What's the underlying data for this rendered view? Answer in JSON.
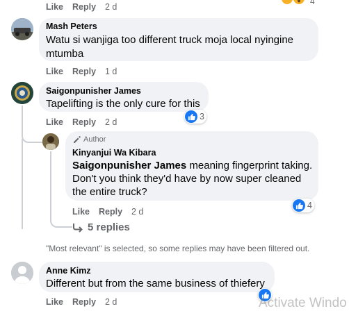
{
  "comment0": {
    "like": "Like",
    "reply": "Reply",
    "time": "2 d",
    "reaction_count": "4"
  },
  "comment1": {
    "author": "Mash Peters",
    "text_line1": "Watu si wanjiga too different truck moja local nyingine",
    "text_line2": "mtumba",
    "like": "Like",
    "reply": "Reply",
    "time": "1 d"
  },
  "comment2": {
    "author": "Saigonpunisher James",
    "text": "Tapelifting is the only cure for this",
    "like": "Like",
    "reply": "Reply",
    "time": "2 d",
    "reaction_count": "3"
  },
  "reply1": {
    "badge": "Author",
    "author": "Kinyanjui Wa Kibara",
    "mention": "Saigonpunisher James",
    "text_line1": " meaning fingerprint taking.",
    "text_line2": "Don't you think they'd have by now super cleaned",
    "text_line3": "the entire truck?",
    "like": "Like",
    "reply": "Reply",
    "time": "2 d",
    "reaction_count": "4"
  },
  "replies_link": "5 replies",
  "filter_notice": "\"Most relevant\" is selected, so some replies may have been filtered out.",
  "comment3": {
    "author": "Anne Kimz",
    "text": "Different but from the same business of thiefery",
    "like": "Like",
    "reply": "Reply",
    "time": "2 d"
  },
  "watermark": "Activate Windo",
  "colors": {
    "accent": "#1877f2",
    "bubble": "#f0f2f5",
    "meta": "#65676b"
  }
}
